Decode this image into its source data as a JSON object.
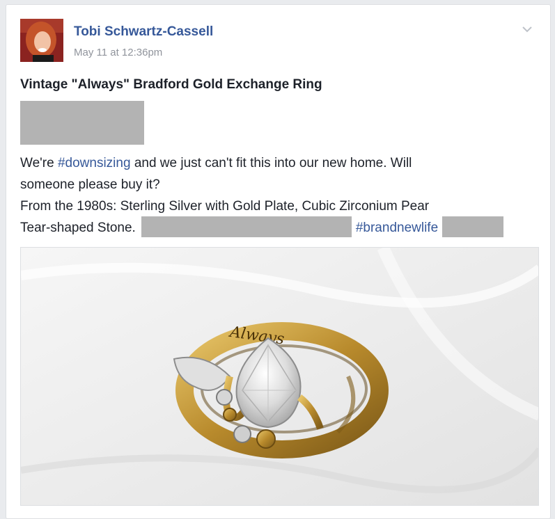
{
  "post": {
    "author": "Tobi Schwartz-Cassell",
    "timestamp": "May 11 at 12:36pm",
    "title": "Vintage \"Always\" Bradford Gold Exchange Ring",
    "body": {
      "line1_pre": "We're ",
      "hashtag_downsizing": "#downsizing",
      "line1_post": " and we just can't fit this into our new home. Will",
      "line2": "someone please buy it?",
      "line3": "From the 1980s: Sterling Silver with Gold Plate, Cubic Zirconium Pear",
      "line4_pre": "Tear-shaped Stone.",
      "hashtag_brandnewlife": "#brandnewlife"
    },
    "photo": {
      "engraving": "Always"
    }
  },
  "icons": {
    "menu": "chevron-down-icon"
  },
  "colors": {
    "link": "#365899",
    "text": "#1d2129",
    "meta": "#90949c",
    "redaction": "#b3b3b3"
  }
}
